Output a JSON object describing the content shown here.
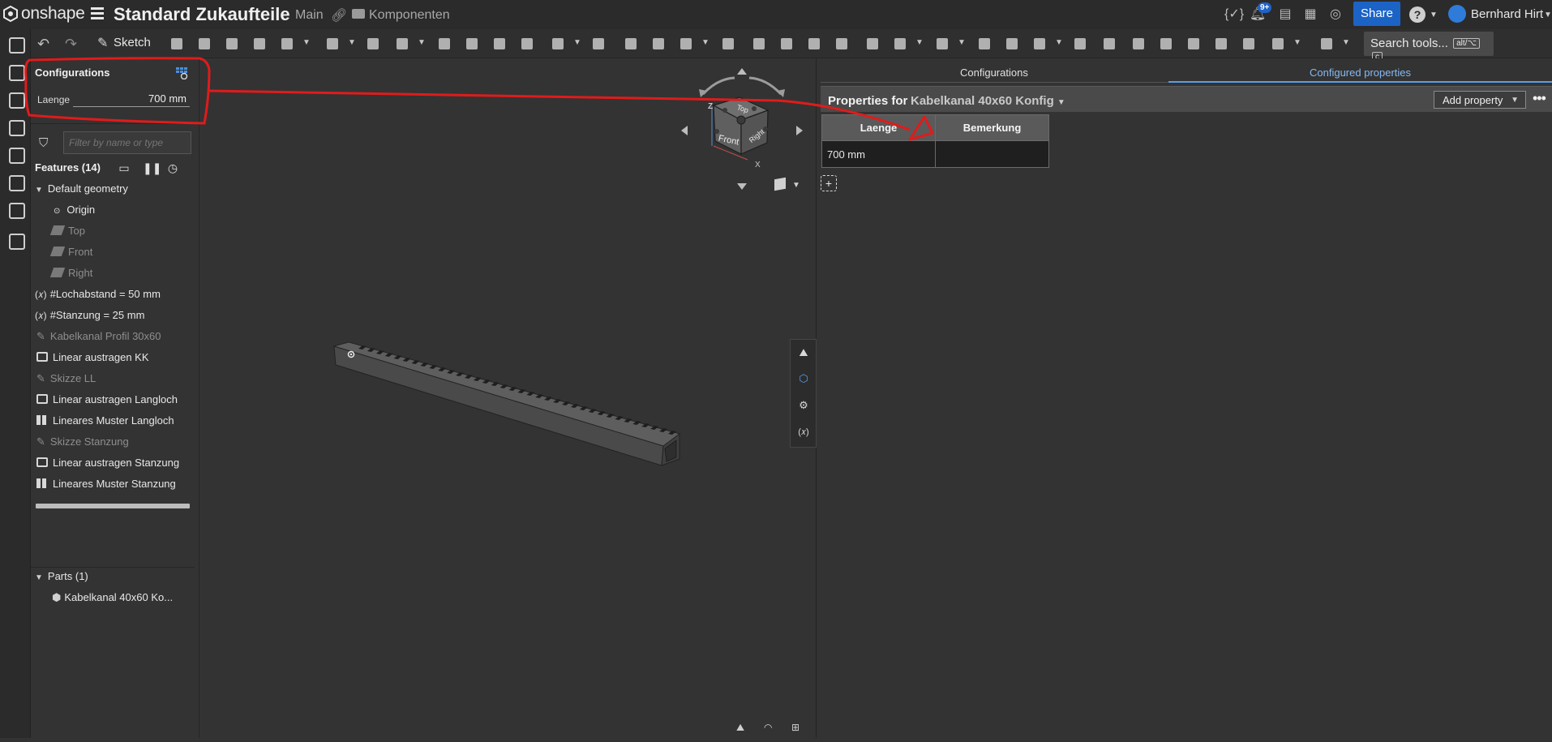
{
  "app": {
    "brand": "onshape",
    "document_title": "Standard Zukaufteile",
    "branch": "Main",
    "folder": "Komponenten",
    "notification_count": "9+",
    "share_label": "Share",
    "user_name": "Bernhard Hirt",
    "accent_color": "#1c63c6"
  },
  "toolbar": {
    "sketch_label": "Sketch",
    "search_label": "Search tools...",
    "search_shortcut_1": "alt/⌥",
    "search_shortcut_2": "c"
  },
  "configurations": {
    "title": "Configurations",
    "input_label": "Laenge",
    "input_value": "700 mm"
  },
  "feature_tree": {
    "filter_placeholder": "Filter by name or type",
    "features_title": "Features (14)",
    "default_geometry_label": "Default geometry",
    "origin": "Origin",
    "planes": [
      "Top",
      "Front",
      "Right"
    ],
    "items": [
      {
        "label": "#Lochabstand = 50 mm",
        "kind": "variable"
      },
      {
        "label": "#Stanzung = 25 mm",
        "kind": "variable"
      },
      {
        "label": "Kabelkanal Profil 30x60",
        "kind": "sketch"
      },
      {
        "label": "Linear austragen KK",
        "kind": "extrude"
      },
      {
        "label": "Skizze LL",
        "kind": "sketch"
      },
      {
        "label": "Linear austragen Langloch",
        "kind": "extrude"
      },
      {
        "label": "Lineares Muster Langloch",
        "kind": "pattern"
      },
      {
        "label": "Skizze Stanzung",
        "kind": "sketch"
      },
      {
        "label": "Linear austragen Stanzung",
        "kind": "extrude"
      },
      {
        "label": "Lineares Muster Stanzung",
        "kind": "pattern"
      }
    ],
    "parts_title": "Parts (1)",
    "part_name": "Kabelkanal 40x60 Ko..."
  },
  "viewcube": {
    "top": "Top",
    "front": "Front",
    "right": "Right",
    "axis_z": "Z",
    "axis_x": "X"
  },
  "right_panel": {
    "tab_configurations": "Configurations",
    "tab_configured_properties": "Configured properties",
    "properties_for_label": "Properties for",
    "properties_target": "Kabelkanal 40x60 Konfig",
    "add_property_label": "Add property",
    "table_headers": [
      "Laenge",
      "Bemerkung"
    ],
    "table_rows": [
      [
        "700 mm",
        ""
      ]
    ]
  }
}
